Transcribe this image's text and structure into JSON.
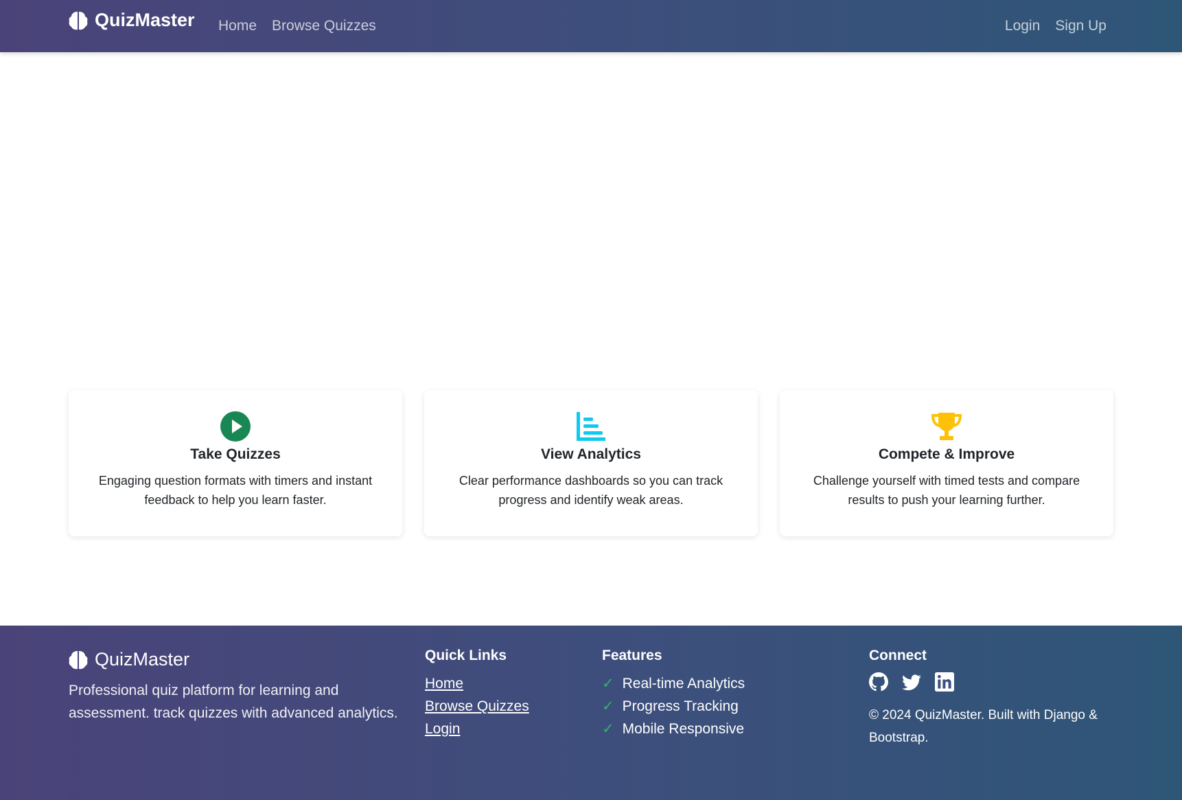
{
  "navbar": {
    "brand": "QuizMaster",
    "links_left": [
      "Home",
      "Browse Quizzes"
    ],
    "links_right": [
      "Login",
      "Sign Up"
    ]
  },
  "features": [
    {
      "icon": "play-circle-icon",
      "title": "Take Quizzes",
      "text": "Engaging question formats with timers and instant feedback to help you learn faster.",
      "color": "#198754"
    },
    {
      "icon": "bar-chart-icon",
      "title": "View Analytics",
      "text": "Clear performance dashboards so you can track progress and identify weak areas.",
      "color": "#0dcaf0"
    },
    {
      "icon": "trophy-icon",
      "title": "Compete & Improve",
      "text": "Challenge yourself with timed tests and compare results to push your learning further.",
      "color": "#ffc107"
    }
  ],
  "footer": {
    "brand": "QuizMaster",
    "description": "Professional quiz platform for learning and assessment. track quizzes with advanced analytics.",
    "quick_links": {
      "title": "Quick Links",
      "items": [
        "Home",
        "Browse Quizzes",
        "Login"
      ]
    },
    "features": {
      "title": "Features",
      "items": [
        "Real-time Analytics",
        "Progress Tracking",
        "Mobile Responsive"
      ]
    },
    "connect": {
      "title": "Connect",
      "icons": [
        "github-icon",
        "twitter-icon",
        "linkedin-icon"
      ]
    },
    "copyright": "© 2024 QuizMaster. Built with Django & Bootstrap."
  },
  "colors": {
    "gradient_start": "#4a4379",
    "gradient_end": "#2e5677",
    "check": "#2fb36b"
  }
}
